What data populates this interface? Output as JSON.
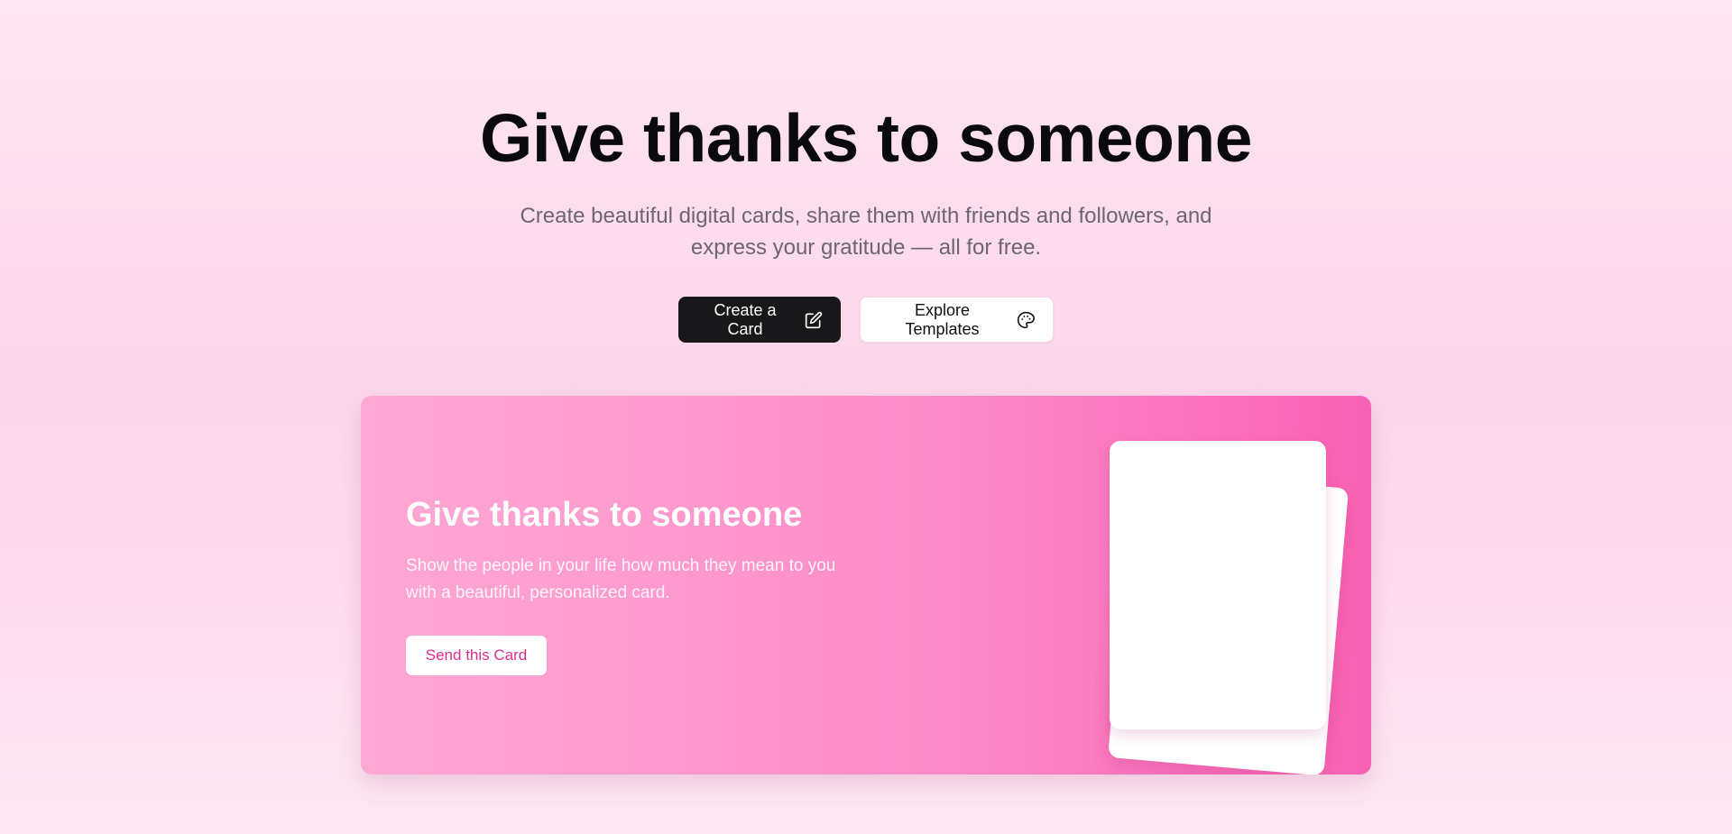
{
  "hero": {
    "title": "Give thanks to someone",
    "subtitle": "Create beautiful digital cards, share them with friends and followers, and express your gratitude — all for free.",
    "primary_cta": {
      "label": "Create a Card",
      "icon": "edit-icon"
    },
    "secondary_cta": {
      "label": "Explore Templates",
      "icon": "palette-icon"
    }
  },
  "feature_card": {
    "title": "Give thanks to someone",
    "description": "Show the people in your life how much they mean to you with a beautiful, personalized card.",
    "button_label": "Send this Card"
  },
  "colors": {
    "page_background": "#FCDDEB",
    "primary_button": "#18181B",
    "card_gradient_start": "#FEA8D4",
    "card_gradient_end": "#F962B3",
    "send_button_text": "#DF2D8F"
  }
}
